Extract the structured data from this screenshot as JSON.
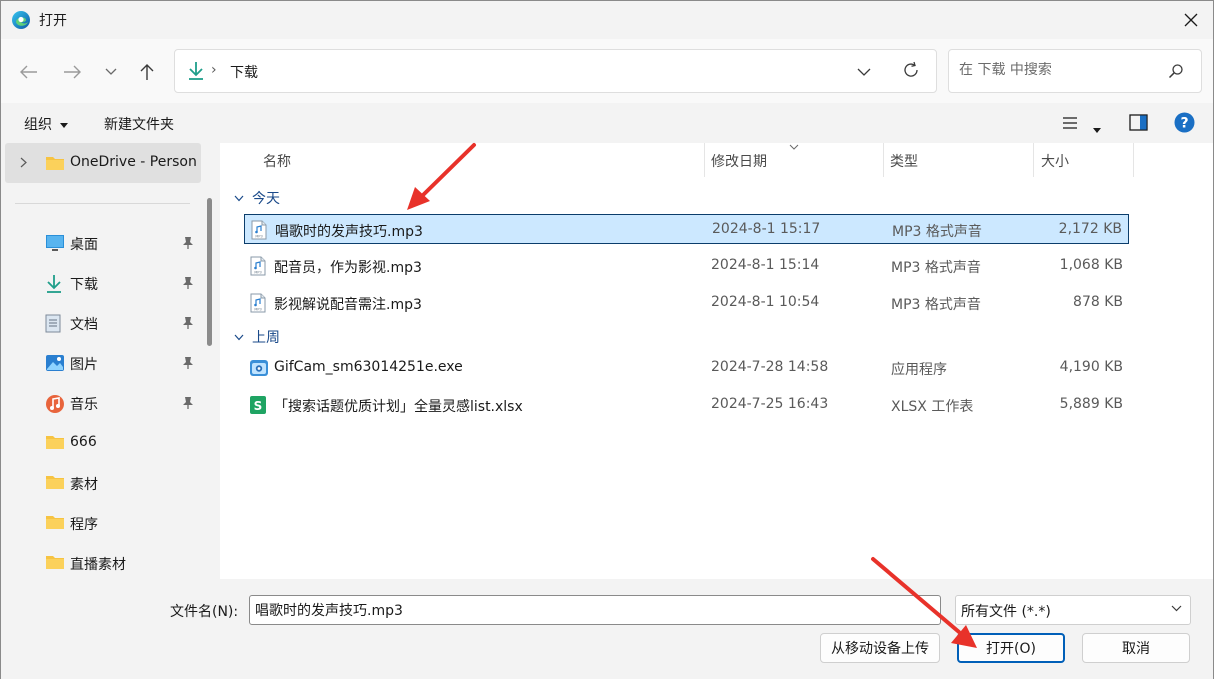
{
  "window": {
    "title": "打开"
  },
  "nav": {
    "breadcrumb_sep": "›",
    "location": "下载",
    "search_placeholder": "在 下载 中搜索"
  },
  "toolbar": {
    "organize": "组织",
    "new_folder": "新建文件夹"
  },
  "sidebar": {
    "onedrive": "OneDrive - Person",
    "items": [
      {
        "label": "桌面",
        "icon": "desktop-icon",
        "pinned": true
      },
      {
        "label": "下载",
        "icon": "download-icon",
        "pinned": true
      },
      {
        "label": "文档",
        "icon": "document-icon",
        "pinned": true
      },
      {
        "label": "图片",
        "icon": "pictures-icon",
        "pinned": true
      },
      {
        "label": "音乐",
        "icon": "music-icon",
        "pinned": true
      },
      {
        "label": "666",
        "icon": "folder-icon",
        "pinned": false
      },
      {
        "label": "素材",
        "icon": "folder-icon",
        "pinned": false
      },
      {
        "label": "程序",
        "icon": "folder-icon",
        "pinned": false
      },
      {
        "label": "直播素材",
        "icon": "folder-icon",
        "pinned": false
      }
    ]
  },
  "list": {
    "columns": [
      "名称",
      "修改日期",
      "类型",
      "大小"
    ],
    "groups": [
      {
        "label": "今天",
        "rows": [
          {
            "name": "唱歌时的发声技巧.mp3",
            "date": "2024-8-1 15:17",
            "type": "MP3 格式声音",
            "size": "2,172 KB",
            "icon": "mp3-file-icon",
            "selected": true
          },
          {
            "name": "配音员，作为影视.mp3",
            "date": "2024-8-1 15:14",
            "type": "MP3 格式声音",
            "size": "1,068 KB",
            "icon": "mp3-file-icon",
            "selected": false
          },
          {
            "name": "影视解说配音需注.mp3",
            "date": "2024-8-1 10:54",
            "type": "MP3 格式声音",
            "size": "878 KB",
            "icon": "mp3-file-icon",
            "selected": false
          }
        ]
      },
      {
        "label": "上周",
        "rows": [
          {
            "name": "GifCam_sm63014251e.exe",
            "date": "2024-7-28 14:58",
            "type": "应用程序",
            "size": "4,190 KB",
            "icon": "exe-file-icon",
            "selected": false
          },
          {
            "name": "「搜索话题优质计划」全量灵感list.xlsx",
            "date": "2024-7-25 16:43",
            "type": "XLSX 工作表",
            "size": "5,889 KB",
            "icon": "xlsx-file-icon",
            "selected": false
          }
        ]
      }
    ]
  },
  "footer": {
    "filename_label": "文件名(N):",
    "filename_value": "唱歌时的发声技巧.mp3",
    "filter": "所有文件 (*.*)",
    "upload_btn": "从移动设备上传",
    "open_btn": "打开(O)",
    "cancel_btn": "取消"
  },
  "colors": {
    "accent": "#005fb8",
    "selection": "#cce8ff",
    "annotation_arrow": "#e8322a"
  }
}
